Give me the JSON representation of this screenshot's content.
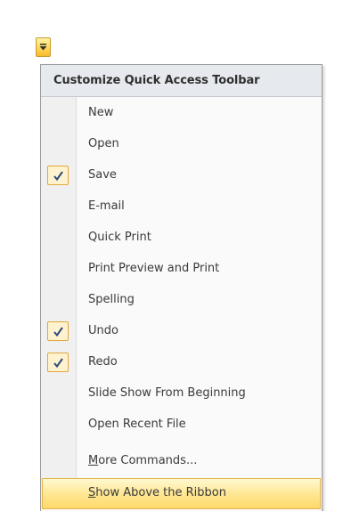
{
  "menu": {
    "header": "Customize Quick Access Toolbar",
    "items": [
      {
        "label": "New",
        "checked": false
      },
      {
        "label": "Open",
        "checked": false
      },
      {
        "label": "Save",
        "checked": true
      },
      {
        "label": "E-mail",
        "checked": false
      },
      {
        "label": "Quick Print",
        "checked": false
      },
      {
        "label": "Print Preview and Print",
        "checked": false
      },
      {
        "label": "Spelling",
        "checked": false
      },
      {
        "label": "Undo",
        "checked": true
      },
      {
        "label": "Redo",
        "checked": true
      },
      {
        "label": "Slide Show From Beginning",
        "checked": false
      },
      {
        "label": "Open Recent File",
        "checked": false
      }
    ],
    "more_commands": "More Commands...",
    "show_above_ribbon": "Show Above the Ribbon"
  },
  "icons": {
    "dropdown": "chevron-down-icon",
    "check": "checkmark-icon"
  },
  "colors": {
    "highlight": "#ffe794",
    "check_border": "#e0a640",
    "check_fill": "#fff3cf",
    "header_bg": "#e6e9ee"
  }
}
